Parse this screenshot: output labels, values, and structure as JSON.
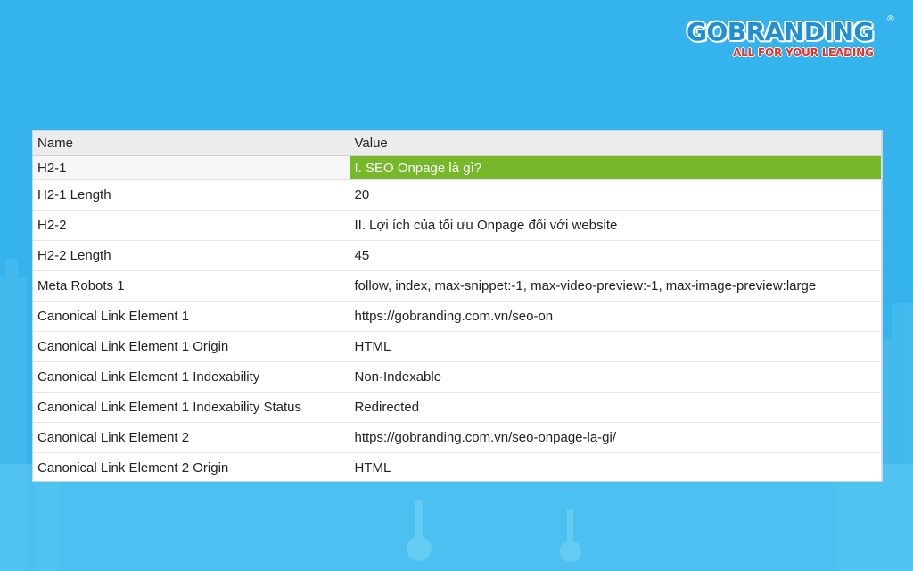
{
  "brand": {
    "name": "GOBRANDING",
    "registered": "®",
    "tagline": "ALL FOR YOUR LEADING",
    "colors": {
      "blue": "#1f8fd6",
      "red": "#e4322b"
    }
  },
  "table": {
    "headers": {
      "name": "Name",
      "value": "Value"
    },
    "selected_color": "#76b82a",
    "rows": [
      {
        "name": "H2-1",
        "value": "I. SEO Onpage là gì?",
        "selected": true
      },
      {
        "name": "H2-1 Length",
        "value": "20"
      },
      {
        "name": "H2-2",
        "value": "II. Lợi ích của tối ưu Onpage đối với website"
      },
      {
        "name": "H2-2 Length",
        "value": "45"
      },
      {
        "name": "Meta Robots 1",
        "value": "follow, index, max-snippet:-1, max-video-preview:-1, max-image-preview:large"
      },
      {
        "name": "Canonical Link Element 1",
        "value": "https://gobranding.com.vn/seo-on"
      },
      {
        "name": "Canonical Link Element 1 Origin",
        "value": "HTML"
      },
      {
        "name": "Canonical Link Element 1 Indexability",
        "value": "Non-Indexable"
      },
      {
        "name": "Canonical Link Element 1 Indexability Status",
        "value": "Redirected"
      },
      {
        "name": "Canonical Link Element 2",
        "value": "https://gobranding.com.vn/seo-onpage-la-gi/"
      },
      {
        "name": "Canonical Link Element 2 Origin",
        "value": "HTML"
      }
    ]
  }
}
